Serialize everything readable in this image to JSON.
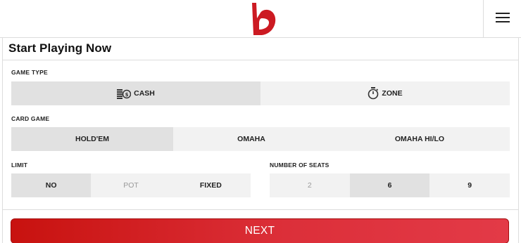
{
  "header": {
    "logo_icon": "brand-b-logo",
    "menu_icon": "hamburger-menu-icon",
    "brand_color": "#cc1a22"
  },
  "form": {
    "title": "Start Playing Now",
    "game_type": {
      "label": "GAME TYPE",
      "options": [
        {
          "label": "CASH",
          "icon": "cash-coins-icon",
          "selected": true
        },
        {
          "label": "ZONE",
          "icon": "stopwatch-icon",
          "selected": false
        }
      ]
    },
    "card_game": {
      "label": "CARD GAME",
      "options": [
        {
          "label": "HOLD'EM",
          "selected": true
        },
        {
          "label": "OMAHA",
          "selected": false
        },
        {
          "label": "OMAHA HI/LO",
          "selected": false
        }
      ]
    },
    "limit": {
      "label": "LIMIT",
      "options": [
        {
          "label": "NO",
          "selected": true,
          "disabled": false
        },
        {
          "label": "POT",
          "selected": false,
          "disabled": true
        },
        {
          "label": "FIXED",
          "selected": false,
          "disabled": false
        }
      ]
    },
    "seats": {
      "label": "NUMBER OF SEATS",
      "options": [
        {
          "label": "2",
          "selected": false,
          "disabled": true
        },
        {
          "label": "6",
          "selected": true,
          "disabled": false
        },
        {
          "label": "9",
          "selected": false,
          "disabled": false
        }
      ]
    },
    "next_label": "NEXT"
  },
  "colors": {
    "selected_bg": "#e1e1e1",
    "unselected_bg": "#f2f2f2",
    "button_start": "#c8120f",
    "button_end": "#e33a47"
  }
}
